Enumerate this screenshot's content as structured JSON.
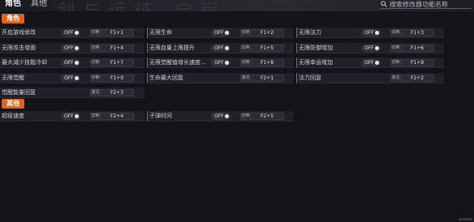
{
  "title_watermark": "剑与远征 启程",
  "tabs": [
    {
      "label": "角色",
      "active": true
    },
    {
      "label": "其他",
      "active": false
    }
  ],
  "search": {
    "placeholder": "搜索修改器功能名称"
  },
  "sections": [
    {
      "label": "角色"
    },
    {
      "label": "其他"
    }
  ],
  "toggle_off_label": "OFF",
  "key_switch_label": "切换",
  "key_activate_label": "激活",
  "rows": {
    "col1": [
      {
        "label": "开启游戏修改",
        "type": "toggle",
        "key": "F1+1"
      },
      {
        "label": "无限攻击增面",
        "type": "toggle",
        "key": "F1+4"
      },
      {
        "label": "最大减少技能冷却",
        "type": "toggle",
        "key": "F1+7"
      },
      {
        "label": "无限觉醒",
        "type": "toggle",
        "key": "F1+0"
      },
      {
        "label": "觉醒能量回复",
        "type": "activate",
        "key": "F2+3"
      }
    ],
    "col2": [
      {
        "label": "无限生命",
        "type": "toggle",
        "key": "F1+2"
      },
      {
        "label": "无限血量上限提升",
        "type": "toggle",
        "key": "F1+5"
      },
      {
        "label": "无限觉醒值增长速度...",
        "type": "toggle",
        "key": "F1+8"
      },
      {
        "label": "生命最大回复",
        "type": "activate",
        "key": "F2+1"
      }
    ],
    "col3": [
      {
        "label": "无限法力",
        "type": "toggle",
        "key": "F1+3"
      },
      {
        "label": "无限防御增加",
        "type": "toggle",
        "key": "F1+6"
      },
      {
        "label": "无限幸运增加",
        "type": "toggle",
        "key": "F1+9"
      },
      {
        "label": "法力回复",
        "type": "activate",
        "key": "F2+2"
      }
    ],
    "other_col1": [
      {
        "label": "超级速度",
        "type": "toggle",
        "key": "F2+4"
      }
    ],
    "other_col2": [
      {
        "label": "子弹时间",
        "type": "toggle",
        "key": "F2+5"
      }
    ]
  },
  "colors": {
    "accent": "#e3621a",
    "background": "#13141a",
    "row_bg": "#1f2028"
  }
}
